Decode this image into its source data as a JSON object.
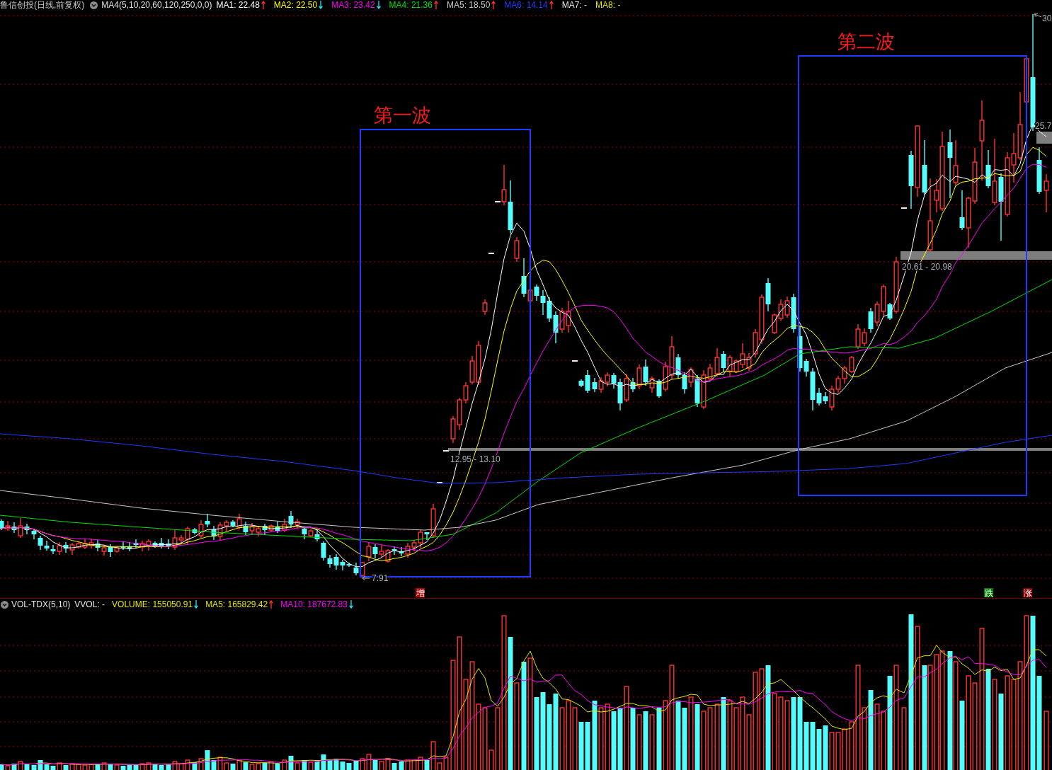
{
  "header": {
    "title": "鲁信创投(日线,前复权)",
    "indicator": "MA4(5,10,20,60,120,250,0,0)",
    "averages": [
      {
        "label": "MA1: 22.48",
        "color": "#ffffff",
        "rising": true
      },
      {
        "label": "MA2: 22.50",
        "color": "#ffff00",
        "rising": false
      },
      {
        "label": "MA3: 23.42",
        "color": "#ff00ff",
        "rising": false
      },
      {
        "label": "MA4: 21.36",
        "color": "#00e000",
        "rising": true
      },
      {
        "label": "MA5: 18.50",
        "color": "#c8c8c8",
        "rising": true
      },
      {
        "label": "MA6: 14.14",
        "color": "#1e3cff",
        "rising": true
      },
      {
        "label": "MA7: -",
        "color": "#e6e6e6"
      },
      {
        "label": "MA8: -",
        "color": "#e6e600"
      }
    ]
  },
  "price_chart": {
    "waves": [
      "第一波",
      "第二波"
    ],
    "zones": [
      "12.95 - 13.10",
      "20.61 - 20.98",
      "25.7"
    ],
    "extremes": [
      "7.91",
      "30"
    ],
    "signals": [
      {
        "label": "增",
        "color": "#b00000"
      },
      {
        "label": "跌",
        "color": "#008000"
      },
      {
        "label": "涨",
        "color": "#8b0000"
      }
    ]
  },
  "volume_header": {
    "indicator": "VOL-TDX(5,10)",
    "items": [
      {
        "label": "VVOL: -",
        "color": "#e6e6e6"
      },
      {
        "label": "VOLUME: 155050.91",
        "color": "#e6e600",
        "rising": false
      },
      {
        "label": "MA5: 165829.42",
        "color": "#e6e600",
        "rising": true
      },
      {
        "label": "MA10: 187672.83",
        "color": "#ff00ff",
        "rising": false
      }
    ]
  }
}
